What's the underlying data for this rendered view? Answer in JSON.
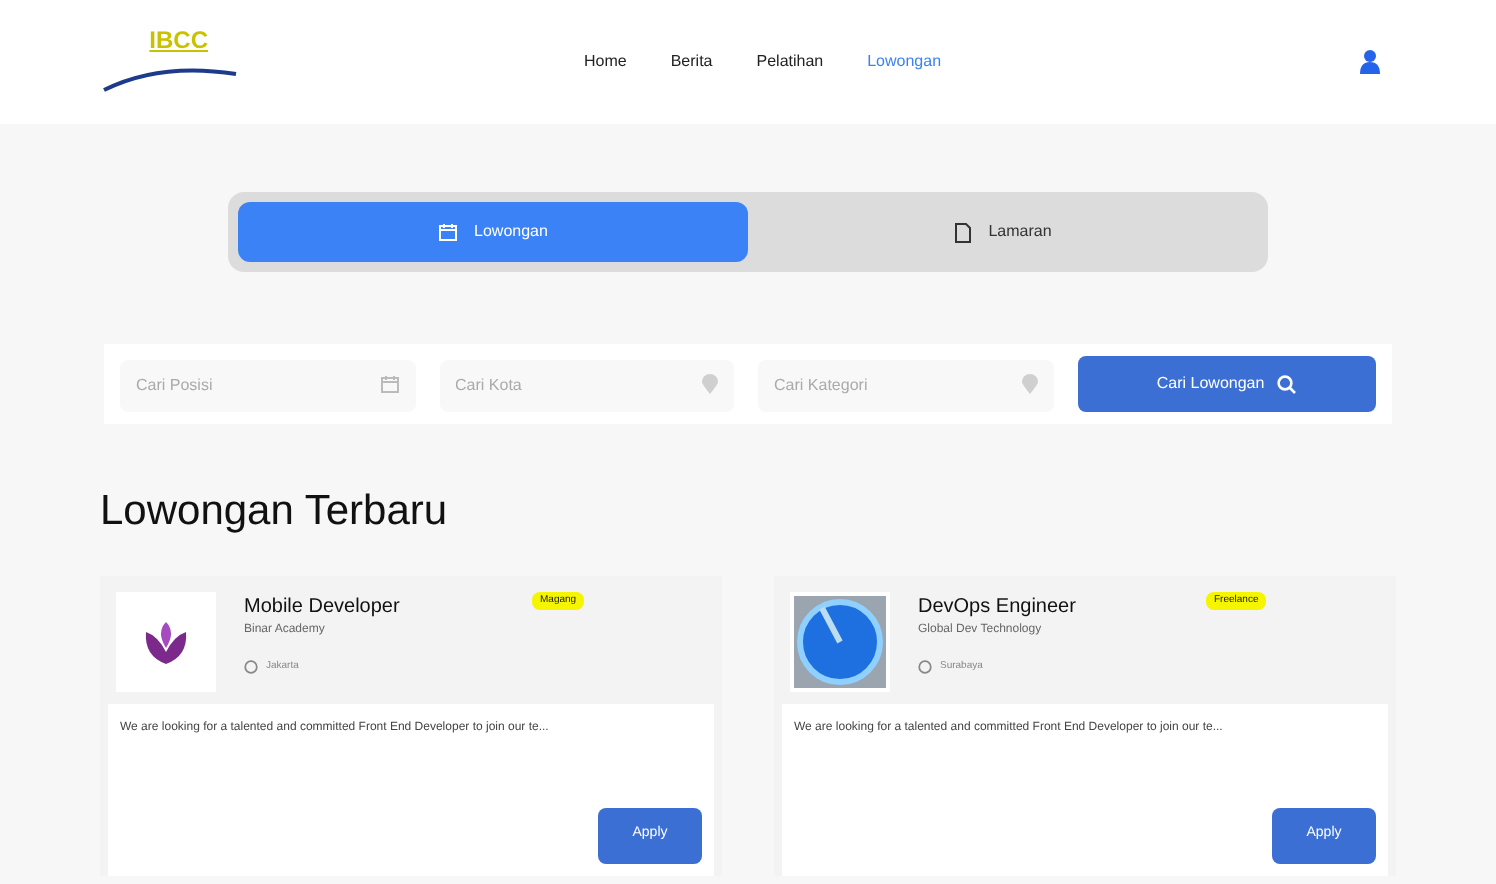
{
  "header": {
    "logo": "IBCC",
    "nav": [
      {
        "label": "Home",
        "selected": false
      },
      {
        "label": "Berita",
        "selected": false
      },
      {
        "label": "Pelatihan",
        "selected": false
      },
      {
        "label": "Lowongan",
        "selected": true
      }
    ]
  },
  "tabs": [
    {
      "label": "Lowongan",
      "selected": true,
      "kind": "calendar"
    },
    {
      "label": "Lamaran",
      "selected": false,
      "kind": "document"
    }
  ],
  "filters": [
    {
      "placeholder": "Cari Posisi",
      "kind": "calendar"
    },
    {
      "placeholder": "Cari Kota",
      "kind": "pin"
    },
    {
      "placeholder": "Cari Kategori",
      "kind": "pin"
    }
  ],
  "search_button": "Cari Lowongan",
  "section_title": "Lowongan Terbaru",
  "jobs": [
    {
      "title": "Mobile Developer",
      "company": "Binar Academy",
      "tag": "Magang",
      "location": "Jakarta",
      "kind": "purple",
      "description": "We are looking for a talented and committed Front End Developer to join our te...",
      "button": "Apply"
    },
    {
      "title": "DevOps Engineer",
      "company": "Global Dev Technology",
      "tag": "Freelance",
      "location": "Surabaya",
      "kind": "blue",
      "description": "We are looking for a talented and committed Front End Developer to join our te...",
      "button": "Apply"
    }
  ]
}
